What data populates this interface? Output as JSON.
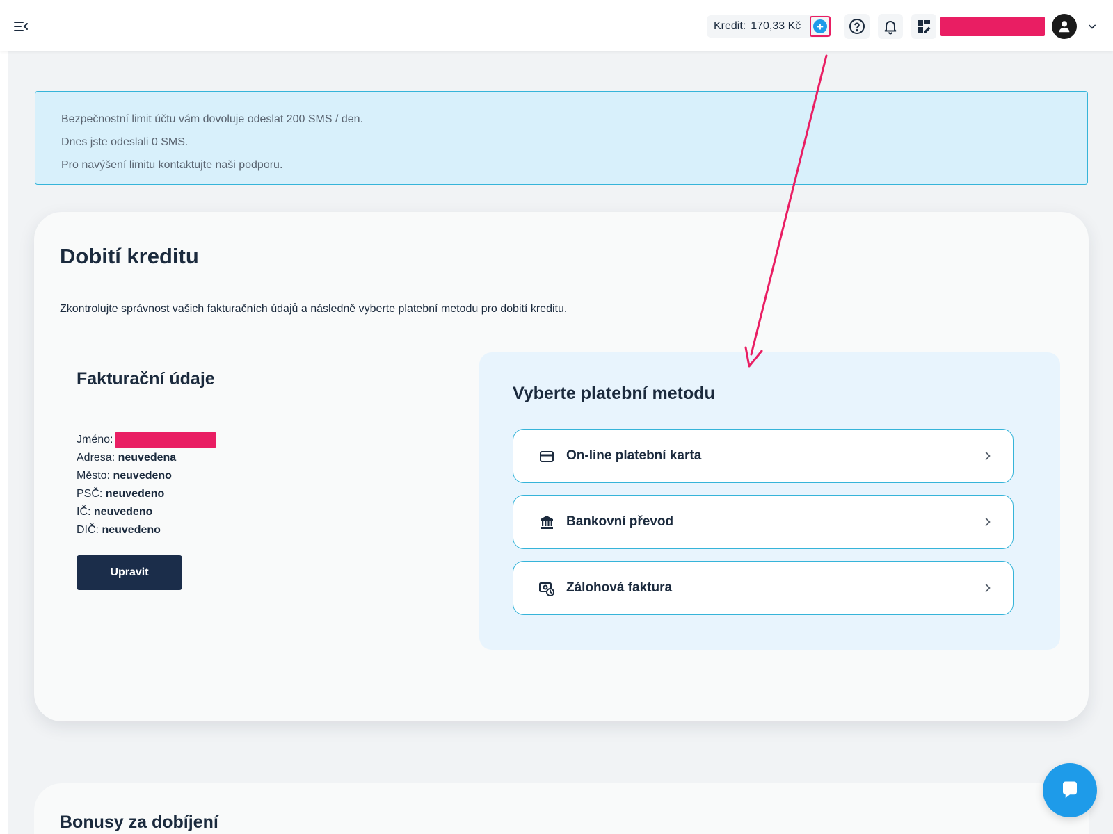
{
  "topbar": {
    "menu_icon": "menu-collapse-icon",
    "credit_label": "Kredit:",
    "credit_value": "170,33 Kč",
    "add_credit_icon": "plus-circle-icon",
    "help_icon": "help-circle-icon",
    "notifications_icon": "bell-icon",
    "dashboard_icon": "dashboard-edit-icon",
    "avatar_icon": "user-icon",
    "caret_icon": "chevron-down-icon"
  },
  "alert": {
    "line1": "Bezpečnostní limit účtu vám dovoluje odeslat 200 SMS / den.",
    "line2": "Dnes jste odeslali 0 SMS.",
    "line3": "Pro navýšení limitu kontaktujte naši podporu."
  },
  "card": {
    "title": "Dobití kreditu",
    "description": "Zkontrolujte správnost vašich fakturačních údajů a následně vyberte platební metodu pro dobití kreditu."
  },
  "billing": {
    "title": "Fakturační údaje",
    "fields": [
      {
        "label": "Jméno:",
        "value": ""
      },
      {
        "label": "Adresa:",
        "value": "neuvedena"
      },
      {
        "label": "Město:",
        "value": "neuvedeno"
      },
      {
        "label": "PSČ:",
        "value": "neuvedeno"
      },
      {
        "label": "IČ:",
        "value": "neuvedeno"
      },
      {
        "label": "DIČ:",
        "value": "neuvedeno"
      }
    ],
    "edit_button": "Upravit"
  },
  "payment": {
    "title": "Vyberte platební metodu",
    "options": [
      {
        "label": "On-line platební karta",
        "icon": "credit-card-icon"
      },
      {
        "label": "Bankovní převod",
        "icon": "bank-icon"
      },
      {
        "label": "Zálohová faktura",
        "icon": "invoice-clock-icon"
      }
    ]
  },
  "bonus": {
    "title": "Bonusy za dobíjení"
  },
  "colors": {
    "accent": "#1e9be9",
    "highlight": "#e91e63",
    "navy": "#1b2d4a",
    "info_bg": "#d8f0fb",
    "info_border": "#36b4d9"
  }
}
